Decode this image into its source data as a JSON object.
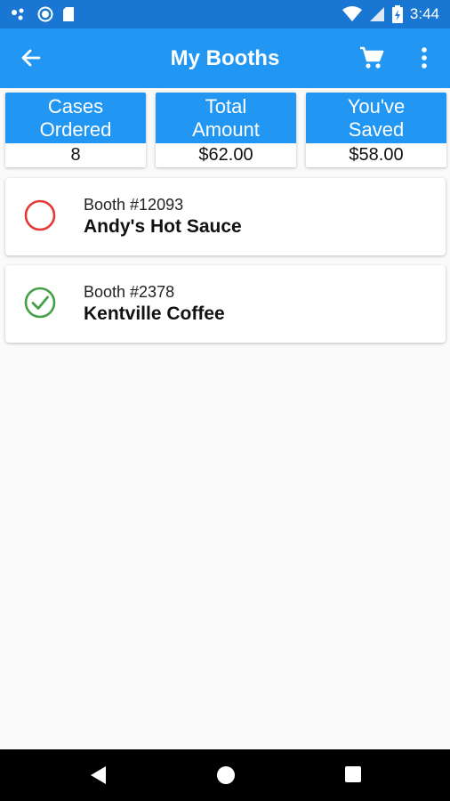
{
  "status_bar": {
    "time": "3:44",
    "icons": [
      "notification-dots-icon",
      "sync-icon",
      "sd-card-icon",
      "wifi-icon",
      "signal-icon",
      "battery-icon"
    ]
  },
  "app_bar": {
    "title": "My Booths",
    "icons": [
      "back-arrow-icon",
      "cart-icon",
      "more-vert-icon"
    ]
  },
  "stats": [
    {
      "label_line1": "Cases",
      "label_line2": "Ordered",
      "value": "8"
    },
    {
      "label_line1": "Total",
      "label_line2": "Amount",
      "value": "$62.00"
    },
    {
      "label_line1": "You've",
      "label_line2": "Saved",
      "value": "$58.00"
    }
  ],
  "booths": [
    {
      "number": "Booth #12093",
      "name": "Andy's Hot Sauce",
      "status": "pending",
      "status_icon": "circle-outline-icon"
    },
    {
      "number": "Booth #2378",
      "name": "Kentville Coffee",
      "status": "done",
      "status_icon": "check-circle-icon"
    }
  ],
  "colors": {
    "primary": "#2196f3",
    "primary_dark": "#1976d2",
    "pending": "#e53935",
    "done": "#43a047",
    "background": "#fafafa"
  },
  "nav_bar": {
    "icons": [
      "back-triangle-icon",
      "home-circle-icon",
      "recents-square-icon"
    ]
  }
}
